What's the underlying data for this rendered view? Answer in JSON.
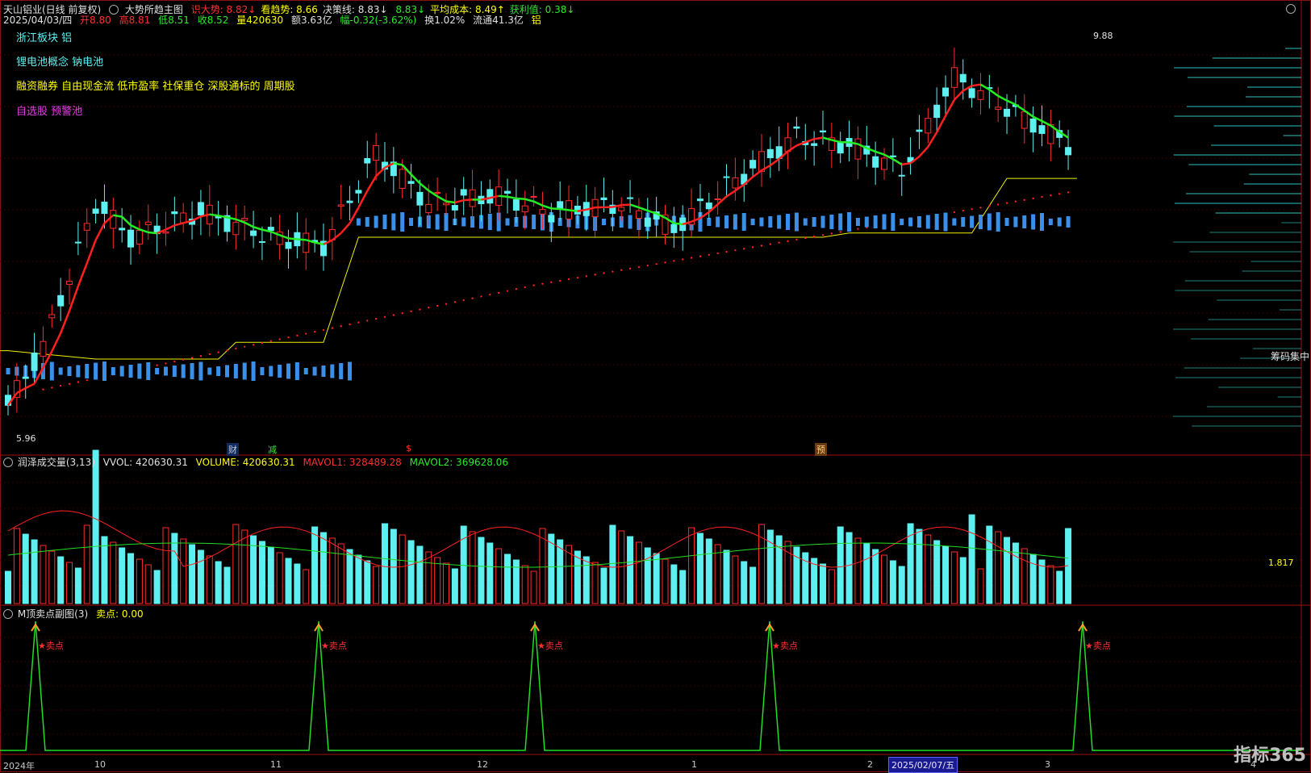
{
  "header": {
    "stock": "天山铝业(日线 前复权)",
    "indicator": "大势所趋主图",
    "items": [
      {
        "label": "识大势:",
        "value": "8.82",
        "arrow": "↓",
        "color": "#ff3030"
      },
      {
        "label": "看趋势:",
        "value": "8.66",
        "arrow": "",
        "color": "#ffff00"
      },
      {
        "label": "决策线:",
        "value": "8.83",
        "arrow": "↓",
        "color": "#e0e0e0"
      },
      {
        "label": "",
        "value": "8.83",
        "arrow": "↓",
        "color": "#2ee82e"
      },
      {
        "label": "平均成本:",
        "value": "8.49",
        "arrow": "↑",
        "color": "#ffff00"
      },
      {
        "label": "获利值:",
        "value": "0.38",
        "arrow": "↓",
        "color": "#2ee82e"
      }
    ],
    "quote": {
      "date": "2025/04/03/四",
      "open": "开8.80",
      "high": "高8.81",
      "low": "低8.51",
      "close": "收8.52",
      "vol": "量420630",
      "amount": "额3.63亿",
      "change": "幅-0.32(-3.62%)",
      "turnover": "换1.02%",
      "float": "流通41.3亿",
      "sector": "铝"
    }
  },
  "tags": {
    "board": "浙江板块 铝",
    "concept": "锂电池概念 钠电池",
    "features": "融资融券 自由现金流 低市盈率 社保重仓 深股通标的 周期股",
    "pool": "自选股 预警池"
  },
  "price_labels": {
    "high": "9.88",
    "low": "5.96",
    "chip": "筹码集中"
  },
  "volume_panel": {
    "title": "润泽成交量(3,13)",
    "vvol": "VVOL: 420630.31",
    "volume": "VOLUME: 420630.31",
    "mavol1": "MAVOL1: 328489.28",
    "mavol2": "MAVOL2: 369628.06",
    "axis_value": "1.817"
  },
  "signal_panel": {
    "title": "M顶卖点副图(3)",
    "sell": "卖点: 0.00",
    "marker": "★卖点"
  },
  "badges": [
    {
      "text": "财",
      "color": "#5ab4ff"
    },
    {
      "text": "减",
      "color": "#2ee82e"
    },
    {
      "text": "$",
      "color": "#ff3030"
    },
    {
      "text": "预",
      "color": "#ff9a2e"
    }
  ],
  "x_axis": {
    "labels": [
      "2024年",
      "10",
      "11",
      "12",
      "1",
      "2",
      "3",
      "4"
    ],
    "highlight": "2025/02/07/五"
  },
  "logo": "指标365",
  "chart_data": {
    "type": "candlestick",
    "period": "daily",
    "price_high": 9.88,
    "price_low": 5.96,
    "last_close": 8.52,
    "sell_signals": 5
  },
  "colors": {
    "up": "#ff2a2a",
    "down": "#5ef0f0",
    "trend_up": "#ff2020",
    "trend_down": "#22ee22",
    "vol_bar": "#3a8fe8"
  }
}
